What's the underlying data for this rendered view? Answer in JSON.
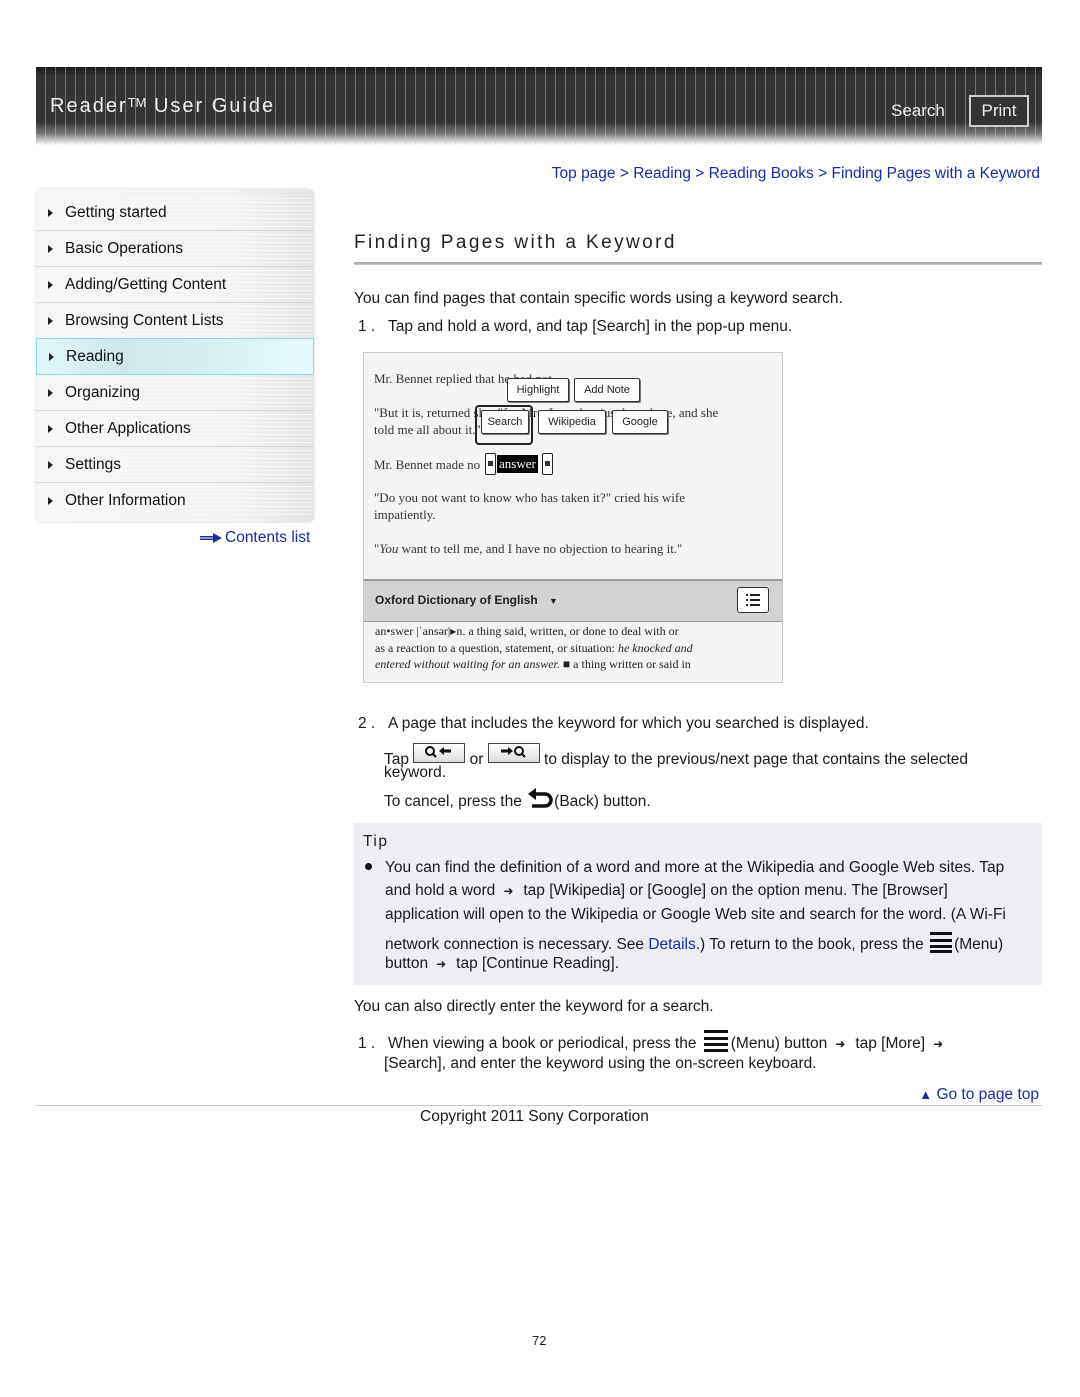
{
  "header": {
    "title": "Reader",
    "trademark": "TM",
    "title_rest": " User Guide",
    "search_label": "Search",
    "print_label": "Print"
  },
  "breadcrumb": {
    "items": [
      "Top page",
      "Reading",
      "Reading Books",
      "Finding Pages with a Keyword"
    ],
    "separator": ">"
  },
  "sidebar": {
    "items": [
      {
        "label": "Getting started",
        "active": false
      },
      {
        "label": "Basic Operations",
        "active": false
      },
      {
        "label": "Adding/Getting Content",
        "active": false
      },
      {
        "label": "Browsing Content Lists",
        "active": false
      },
      {
        "label": "Reading",
        "active": true
      },
      {
        "label": "Organizing",
        "active": false
      },
      {
        "label": "Other Applications",
        "active": false
      },
      {
        "label": "Settings",
        "active": false
      },
      {
        "label": "Other Information",
        "active": false
      }
    ],
    "contents_list_label": "Contents list"
  },
  "main": {
    "title": "Finding Pages with a Keyword",
    "intro": "You can find pages that contain specific words using a keyword search.",
    "step1_num": "1 .",
    "step1": "Tap and hold a word, and tap [Search] in the pop-up menu.",
    "figure": {
      "line1": "Mr. Bennet replied that he had not.",
      "line2a": "\"But it is, returned she; \"for Mrs. Long has just been here, and she",
      "line2b": "told me all about it.\"",
      "line3": "Mr. Bennet made no",
      "selected_word": "answer",
      "line4a": "\"Do you not want to know who has taken it?\" cried his wife",
      "line4b": "impatiently.",
      "line5_italic": "You",
      "line5": " want to tell me, and I have no objection to hearing it.\"",
      "popup_row1": [
        "Highlight",
        "Add Note"
      ],
      "popup_row2": [
        "Search",
        "Wikipedia",
        "Google"
      ],
      "dictionary_name": "Oxford Dictionary of English",
      "dict_line1": "an•swer |ˈansər|▸n.   a thing said, written, or done to deal with or",
      "dict_line2a": "as a reaction to a question, statement, or situation: ",
      "dict_line2b_italic": "he knocked and",
      "dict_line3_italic": "entered without waiting for an answer.",
      "dict_line3b": "  ■ a thing written or said in"
    },
    "step2_num": "2 .",
    "step2": "A page that includes the keyword for which you searched is displayed.",
    "step2_tap": "Tap",
    "step2_or": "or",
    "step2_rest": "to display to the previous/next page that contains the selected",
    "step2_rest2": "keyword.",
    "step2_cancel_a": "To cancel, press the",
    "step2_cancel_b": "(Back) button.",
    "tip": {
      "label": "Tip",
      "line1": "You can find the definition of a word and more at the Wikipedia and Google Web sites. Tap",
      "line2a": "and hold a word",
      "line2b": "tap [Wikipedia] or [Google] on the option menu. The [Browser]",
      "line3": "application will open to the Wikipedia or Google Web site and search for the word. (A Wi-Fi",
      "line4a": "network connection is necessary. See ",
      "details_link": "Details",
      "line4b": ".) To return to the book, press the",
      "line4c": "(Menu)",
      "line5a": "button",
      "line5b": "tap [Continue Reading]."
    },
    "also": "You can also directly enter the keyword for a search.",
    "step3_num": "1 .",
    "step3a": "When viewing a book or periodical, press the",
    "step3b": "(Menu) button",
    "step3c": "tap [More]",
    "step3d": "[Search], and enter the keyword using the on-screen keyboard."
  },
  "footer": {
    "go_to_top": "Go to page top",
    "copyright": "Copyright 2011 Sony Corporation",
    "page_number": "72"
  },
  "colors": {
    "link": "#1a2ba8",
    "header_bg": "#2e2e2e",
    "tip_bg": "#eceef4",
    "sidebar_active": "#d4eef2"
  }
}
